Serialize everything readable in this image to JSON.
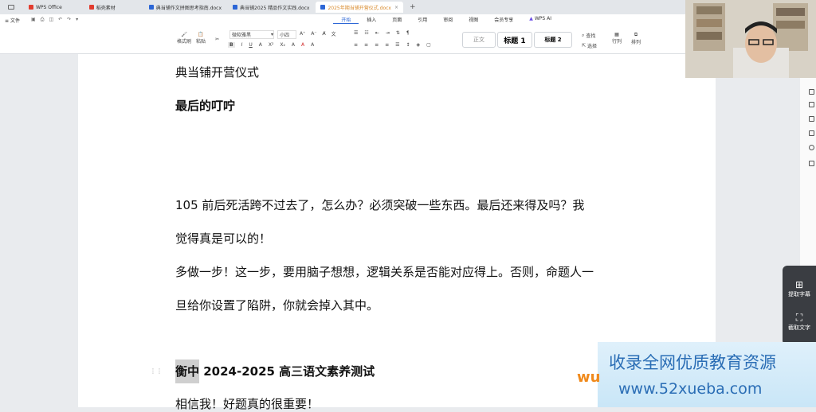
{
  "tabs": [
    {
      "label": "WPS Office",
      "color": "#e23b2e"
    },
    {
      "label": "稻壳素材",
      "color": "#e23b2e"
    },
    {
      "label": "典当铺作文拼图思考指南.docx",
      "color": "#2c66d6"
    },
    {
      "label": "典当铺2025 精品作文实践.docx",
      "color": "#2c66d6"
    },
    {
      "label": "2025年期当铺开营仪式.docx",
      "color": "#2c66d6",
      "active": true
    }
  ],
  "menu": {
    "file": "文件",
    "items": [
      "开始",
      "插入",
      "页面",
      "引用",
      "审阅",
      "视图",
      "会员专享",
      "WPS AI"
    ]
  },
  "ribbon": {
    "format_painter": "格式刷",
    "paste": "粘贴",
    "font_name": "微软雅黑",
    "font_size": "小四",
    "style_normal": "正文",
    "style_h1": "标题 1",
    "style_h2": "标题 2",
    "find": "查找",
    "select": "选择",
    "row_col": "行列",
    "layout": "排列"
  },
  "document": {
    "title": "典当铺开营仪式",
    "subtitle": "最后的叮咛",
    "p1": "105 前后死活跨不过去了，怎么办？必须突破一些东西。最后还来得及吗？我",
    "p1b": "觉得真是可以的！",
    "p2": "多做一步！这一步，要用脑子想想，逻辑关系是否能对应得上。否则，命题人一",
    "p2b": "旦给你设置了陷阱，你就会掉入其中。",
    "heading_highlight": "衡中",
    "heading_rest": " 2024-2025 高三语文素养测试",
    "last": "相信我！好题真的很重要！"
  },
  "side_panel": {
    "item1": "提取字幕",
    "item2": "截取文字"
  },
  "promo": {
    "line1": "收录全网优质教育资源",
    "line2": "www.52xueba.com",
    "mark": "wu"
  }
}
